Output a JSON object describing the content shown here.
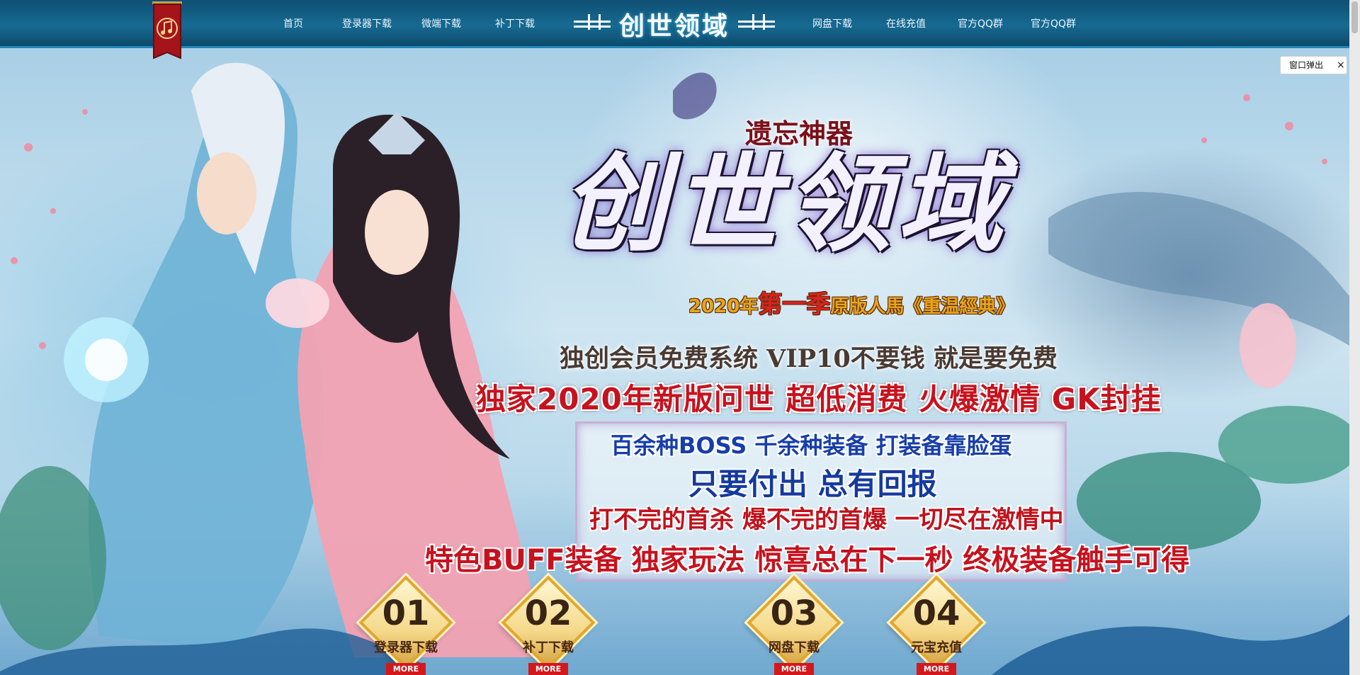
{
  "nav": {
    "items": [
      {
        "label": "首页"
      },
      {
        "label": "登录器下载"
      },
      {
        "label": "微端下载"
      },
      {
        "label": "补丁下载"
      },
      {
        "label": "网盘下载"
      },
      {
        "label": "在线充值"
      },
      {
        "label": "官方QQ群"
      },
      {
        "label": "官方QQ群"
      }
    ],
    "logo_text": "创世领域"
  },
  "hero": {
    "subtitle_top": "遗忘神器",
    "main_title": "创世领域",
    "season": {
      "prefix": "2020年",
      "highlight": "第一季",
      "suffix": "原版人馬《重温經典》"
    },
    "tagline_1": "独创会员免费系统 VIP10不要钱 就是要免费",
    "tagline_2": "独家2020年新版问世 超低消费 火爆激情 GK封挂",
    "box": {
      "line_1": "百余种BOSS 千余种装备 打装备靠脸蛋",
      "line_2": "只要付出 总有回报",
      "line_3": "打不完的首杀 爆不完的首爆 一切尽在激情中"
    },
    "tagline_3": "特色BUFF装备 独家玩法 惊喜总在下一秒 终极装备触手可得"
  },
  "buttons": [
    {
      "num": "01",
      "label": "登录器下载",
      "more": "MORE"
    },
    {
      "num": "02",
      "label": "补丁下载",
      "more": "MORE"
    },
    {
      "num": "03",
      "label": "网盘下载",
      "more": "MORE"
    },
    {
      "num": "04",
      "label": "元宝充值",
      "more": "MORE"
    }
  ],
  "popup": {
    "label": "窗口弹出",
    "close": "×"
  },
  "colors": {
    "nav_bg": "#176a92",
    "accent_red": "#c7121e",
    "accent_blue": "#153a9e",
    "gold": "#e2a72c"
  }
}
